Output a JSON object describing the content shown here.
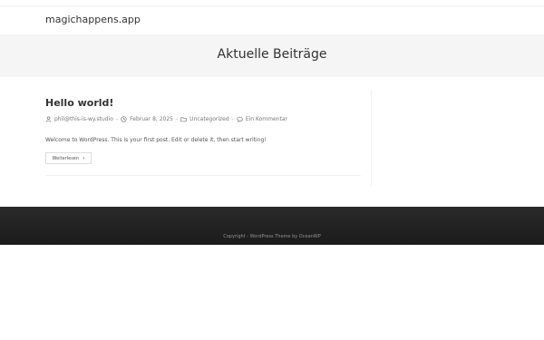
{
  "site": {
    "title": "magichappens.app"
  },
  "page_header": {
    "title": "Aktuelle Beiträge"
  },
  "post": {
    "title": "Hello world!",
    "author": "phil@this-is-wy.studio",
    "date": "Februar 8, 2025",
    "category": "Uncategorized",
    "comments": "Ein Kommentar",
    "excerpt": "Welcome to WordPress. This is your first post. Edit or delete it, then start writing!",
    "read_more": "Weiterlesen"
  },
  "footer": {
    "copyright": "Copyright - WordPress Theme by OceanWP"
  },
  "icons": [
    "user-icon",
    "clock-icon",
    "folder-icon",
    "comment-icon",
    "chevron-right-icon"
  ]
}
